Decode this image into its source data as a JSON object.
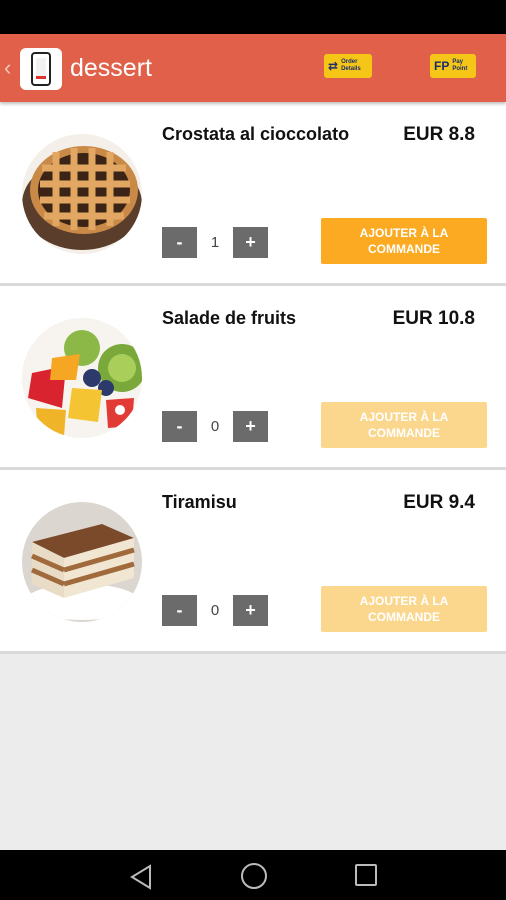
{
  "appbar": {
    "title": "dessert",
    "order_badge": {
      "glyph": "⇄",
      "line1": "Order",
      "line2": "Details"
    },
    "pay_badge": {
      "glyph": "FP",
      "line1": "Pay",
      "line2": "Point"
    }
  },
  "items": [
    {
      "name": "Crostata al cioccolato",
      "price": "EUR 8.8",
      "qty": "1",
      "minus": "-",
      "plus": "+",
      "add_label": "AJOUTER À LA COMMANDE",
      "enabled": true
    },
    {
      "name": "Salade de fruits",
      "price": "EUR 10.8",
      "qty": "0",
      "minus": "-",
      "plus": "+",
      "add_label": "AJOUTER À LA COMMANDE",
      "enabled": false
    },
    {
      "name": "Tiramisu",
      "price": "EUR 9.4",
      "qty": "0",
      "minus": "-",
      "plus": "+",
      "add_label": "AJOUTER À LA COMMANDE",
      "enabled": false
    }
  ],
  "colors": {
    "appbar": "#e0604a",
    "add_enabled": "#fbaa22",
    "add_disabled": "#fbd78d"
  }
}
